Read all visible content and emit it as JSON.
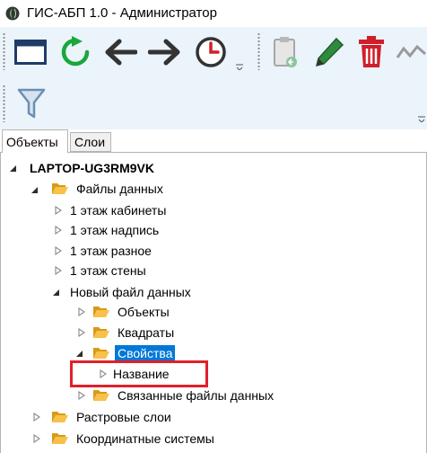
{
  "window": {
    "title": "ГИС-АБП 1.0 - Администратор"
  },
  "toolbar": {
    "buttons": [
      {
        "name": "window",
        "icon": "window-icon"
      },
      {
        "name": "refresh",
        "icon": "refresh-icon"
      },
      {
        "name": "back",
        "icon": "arrow-left-icon"
      },
      {
        "name": "forward",
        "icon": "arrow-right-icon"
      },
      {
        "name": "history",
        "icon": "clock-icon"
      },
      {
        "name": "paste",
        "icon": "clipboard-icon"
      },
      {
        "name": "edit",
        "icon": "pencil-icon"
      },
      {
        "name": "delete",
        "icon": "trash-icon"
      },
      {
        "name": "chart",
        "icon": "chart-icon"
      },
      {
        "name": "filter",
        "icon": "filter-icon"
      }
    ]
  },
  "tabs": [
    {
      "label": "Объекты",
      "active": true
    },
    {
      "label": "Слои",
      "active": false
    }
  ],
  "tree": {
    "root": "LAPTOP-UG3RM9VK",
    "data_files": "Файлы данных",
    "floor_offices": "1 этаж кабинеты",
    "floor_caption": "1 этаж надпись",
    "floor_misc": "1 этаж разное",
    "floor_walls": "1 этаж стены",
    "new_data_file": "Новый файл данных",
    "objects": "Объекты",
    "squares": "Квадраты",
    "properties": "Свойства",
    "name": "Название",
    "linked_files": "Связанные файлы данных",
    "raster_layers": "Растровые слои",
    "coord_systems": "Координатные системы"
  },
  "colors": {
    "selection": "#0078d7",
    "highlight": "#e0202a",
    "folder": "#f5b631",
    "toolbar_bg": "#ebf3fb"
  }
}
